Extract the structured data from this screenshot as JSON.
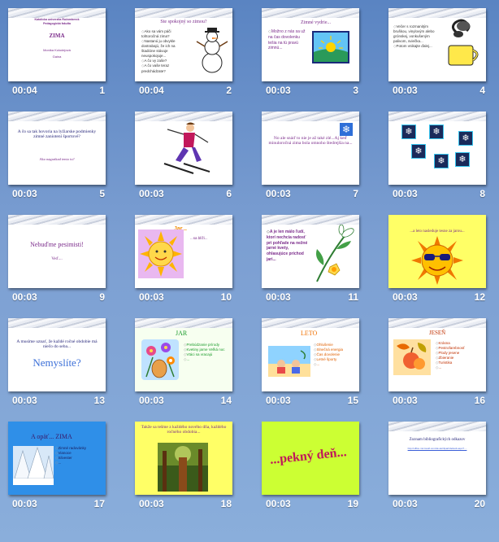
{
  "slides": [
    {
      "num": "1",
      "time": "00:04",
      "lines": [
        "Katolícka univerzita Ružomberok",
        "Pedagogická fakulta",
        "ZIMA",
        "Monika Kolodejová",
        "Gaina"
      ]
    },
    {
      "num": "2",
      "time": "00:04",
      "title": "Ste spokojný so zimou?",
      "bullets": [
        "Ako sa vám páči tohtoročná zima?",
        "Nastanú ju obvykle dostrabajú, že ich na štadióne stávuje neuspokojuje...",
        "A čo vy zaše?",
        "A čo vaše teraz predchádzate?"
      ],
      "icon": "snowman-icon"
    },
    {
      "num": "3",
      "time": "00:03",
      "title": "Zimné vydrie...",
      "bullets": [
        "Možno z nás sa už na čas dovolenku tešia na tú pravú zimnú..."
      ],
      "icon": "winter-sun-icon"
    },
    {
      "num": "4",
      "time": "00:03",
      "bullets": [
        "Večer s rozmanitým bruškou, vinylovým alebo grónskej, vonkušeným palivom, sviečka...",
        "Potom vnikajte ďalej..."
      ],
      "icon": "tea-cup-icon"
    },
    {
      "num": "5",
      "time": "00:03",
      "lines": [
        "A čo sa tak hovoria na lyžiarske podmienky zimné zaniotení športové?",
        "Ako nagratkad tento tu?"
      ]
    },
    {
      "num": "6",
      "time": "00:03",
      "icon": "skier-icon"
    },
    {
      "num": "7",
      "time": "00:03",
      "lines": [
        "No ale snáď to nie je až také zlé...Aj keď minuloročná zima bola omnoho štedrejšia na..."
      ],
      "icon": "snowflake-icon"
    },
    {
      "num": "8",
      "time": "00:03",
      "icon": "snowflakes-pattern-icon"
    },
    {
      "num": "9",
      "time": "00:03",
      "lines": [
        "Nebuďme pesimisti!",
        "Veď...."
      ]
    },
    {
      "num": "10",
      "time": "00:03",
      "title": "Jar...",
      "subtitle": "...sa blíži...",
      "icon": "sun-face-icon"
    },
    {
      "num": "11",
      "time": "00:03",
      "bullets": [
        "A je len málo ľudí, ktorí nechcia radosť pri pohľade na nežné jarné kvety, ohlasujúce príchod jari..."
      ],
      "icon": "daffodil-icon"
    },
    {
      "num": "12",
      "time": "00:03",
      "title": "...a leto nasleduje tesne za jarou...",
      "icon": "sun-glasses-icon"
    },
    {
      "num": "13",
      "time": "00:03",
      "lines": [
        "A musíme uznať, že každé ročné obdobie má niečo do seba...",
        "Nemyslíte?"
      ]
    },
    {
      "num": "14",
      "time": "00:03",
      "title": "JAR",
      "bullets": [
        "Prebúdzanie prírody",
        "Kvetiny jarne Veľká noc",
        "Vtáci sa vracajú",
        "..."
      ],
      "icon": "flowers-icon"
    },
    {
      "num": "15",
      "time": "00:03",
      "title": "LETO",
      "bullets": [
        "Ohlušenie",
        "Slnečná energia",
        "Čas dovolenie",
        "Letné športy",
        "..."
      ],
      "icon": "beach-icon"
    },
    {
      "num": "16",
      "time": "00:03",
      "title": "JESEŇ",
      "bullets": [
        "Krásna",
        "Pestrofarebnosť",
        "Plody jesene",
        "Zbieranie",
        "Turistika",
        "..."
      ],
      "icon": "autumn-fruit-icon"
    },
    {
      "num": "17",
      "time": "00:03",
      "title": "A opäť... ZIMA",
      "bullets": [
        "Zimné radovánky",
        "Vianoce",
        "Silvester",
        "..."
      ],
      "icon": "snowy-trees-icon"
    },
    {
      "num": "18",
      "time": "00:03",
      "lines": [
        "Takže sa tešme z každého nového dňa, každého ročného obdobia..."
      ],
      "icon": "forest-icon"
    },
    {
      "num": "19",
      "time": "00:03",
      "lines": [
        "...pekný deň..."
      ]
    },
    {
      "num": "20",
      "time": "00:03",
      "lines": [
        "Zoznam bibliografických odkazov",
        "http://office.microsoft.com/sk-sk/clipart/default.aspx?...."
      ]
    }
  ],
  "colors": {
    "background": "#6f93cb",
    "timing_text": "#ffffff",
    "purple_text": "#7a2a8a",
    "navy_text": "#26267a",
    "yellow_fill": "#ffff66",
    "lime_fill": "#ccff33",
    "blue_fill": "#2f8fe8"
  }
}
